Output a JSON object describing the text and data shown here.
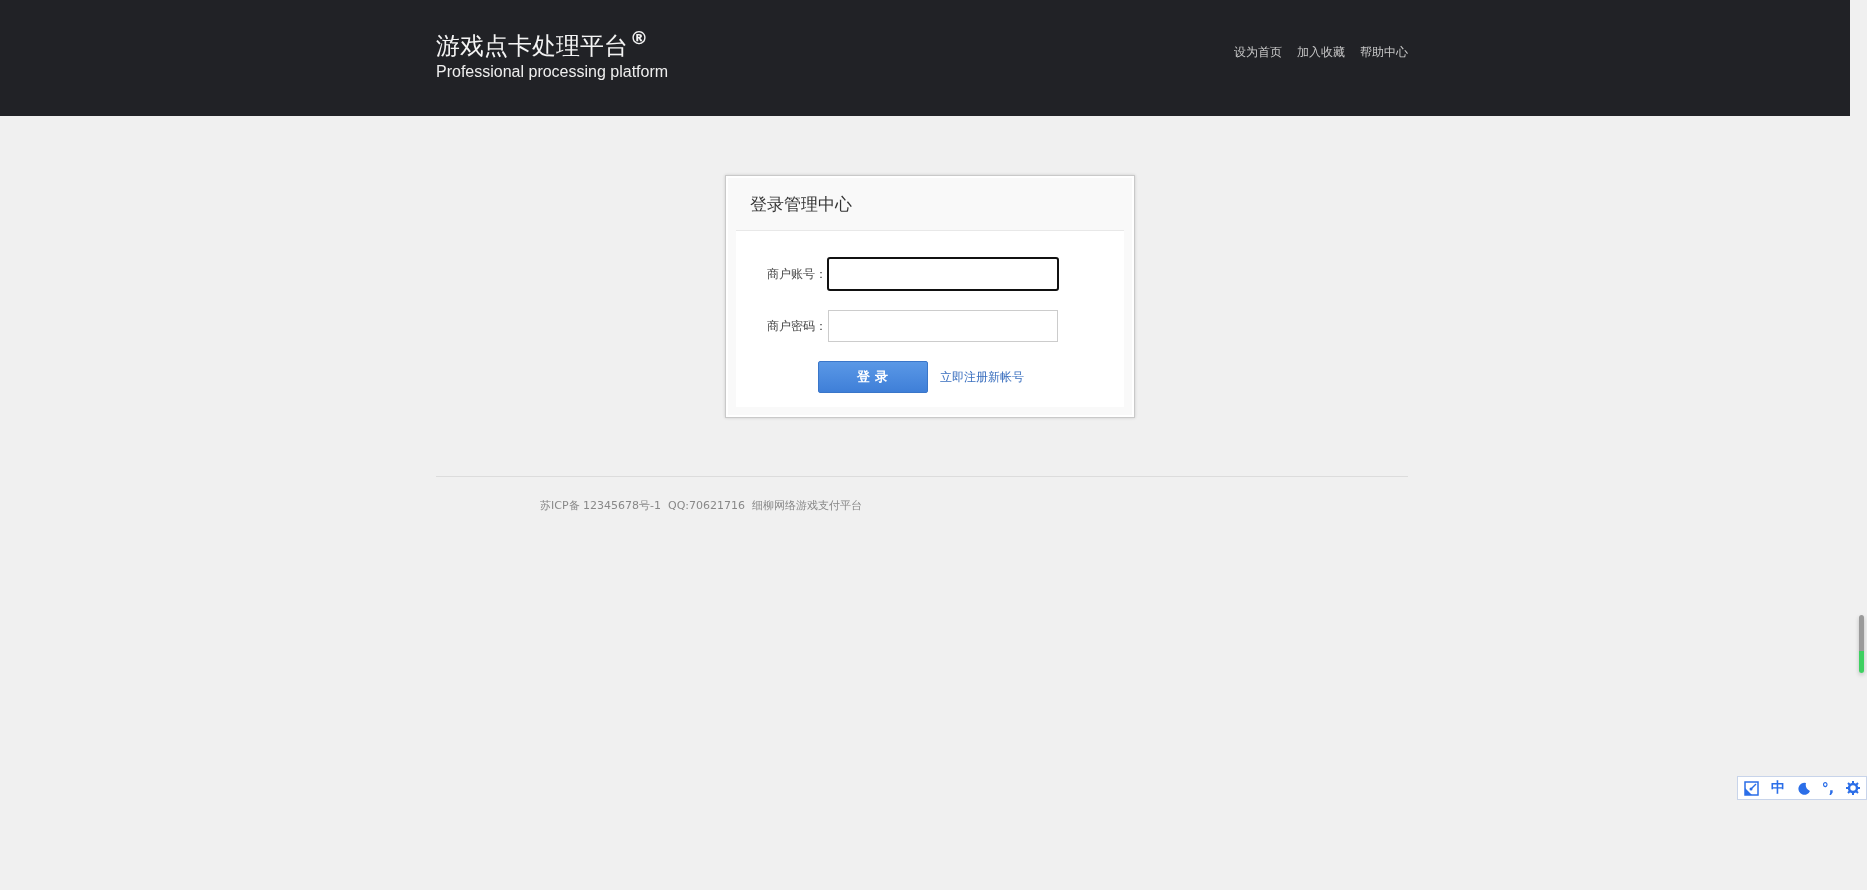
{
  "header": {
    "title": "游戏点卡处理平台",
    "title_mark": "®",
    "subtitle": "Professional processing platform",
    "links": [
      "设为首页",
      "加入收藏",
      "帮助中心"
    ]
  },
  "login_card": {
    "title": "登录管理中心",
    "fields": [
      {
        "label": "商户账号：",
        "focused": true
      },
      {
        "label": "商户密码：",
        "focused": false
      }
    ],
    "submit": "登 录",
    "register_link": "立即注册新帐号"
  },
  "footer": {
    "text": "苏ICP备 12345678号-1  QQ:70621716  细柳网络游戏支付平台"
  },
  "ime_toolbar": {
    "mode": "中",
    "punctuation": "°,"
  }
}
